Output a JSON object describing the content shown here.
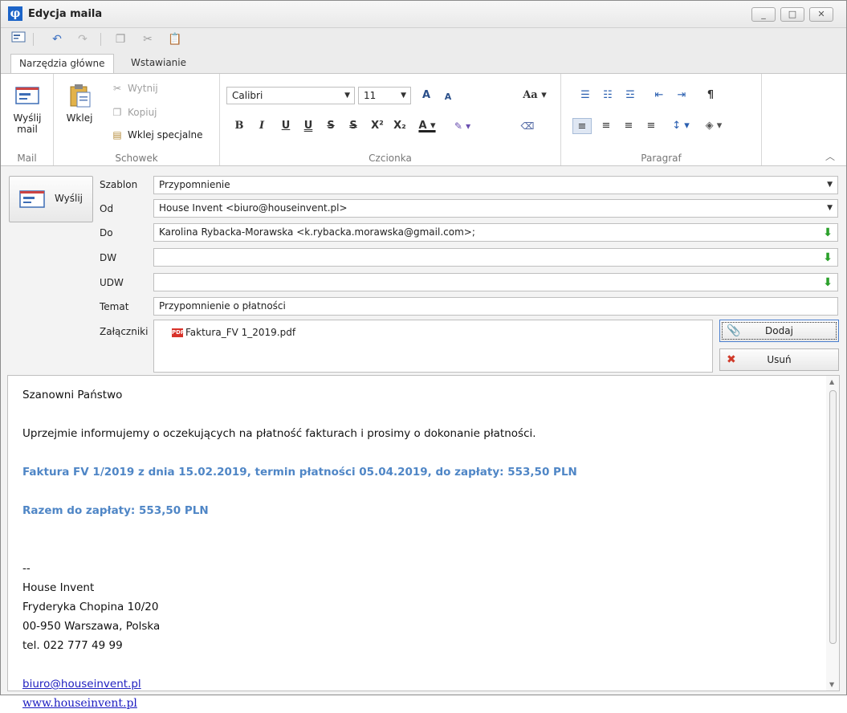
{
  "window": {
    "title": "Edycja maila",
    "minimize": "_",
    "maximize": "□",
    "close": "✕"
  },
  "tabs": [
    {
      "label": "Narzędzia główne"
    },
    {
      "label": "Wstawianie"
    }
  ],
  "ribbon": {
    "mail": {
      "caption": "Mail",
      "send_label_1": "Wyślij",
      "send_label_2": "mail"
    },
    "clipboard": {
      "caption": "Schowek",
      "paste": "Wklej",
      "cut": "Wytnij",
      "copy": "Kopiuj",
      "paste_special": "Wklej specjalne"
    },
    "font": {
      "caption": "Czcionka",
      "family": "Calibri",
      "size": "11",
      "bold": "B",
      "italic": "I",
      "underline": "U",
      "double_underline": "U",
      "strike": "S",
      "double_strike": "S",
      "superscript": "X²",
      "subscript": "X₂",
      "font_color": "A",
      "change_case": "Aa",
      "grow": "A",
      "shrink": "A"
    },
    "paragraph": {
      "caption": "Paragraf",
      "pilcrow": "¶"
    }
  },
  "form": {
    "send": "Wyślij",
    "labels": {
      "template": "Szablon",
      "from": "Od",
      "to": "Do",
      "cc": "DW",
      "bcc": "UDW",
      "subject": "Temat",
      "attachments": "Załączniki"
    },
    "template": "Przypomnienie",
    "from": "House Invent <biuro@houseinvent.pl>",
    "to": "Karolina Rybacka-Morawska <k.rybacka.morawska@gmail.com>;",
    "cc": "",
    "bcc": "",
    "subject": "Przypomnienie o płatności",
    "attachment_file": "Faktura_FV 1_2019.pdf",
    "add_button": "Dodaj",
    "remove_button": "Usuń"
  },
  "body": {
    "greeting": "Szanowni Państwo",
    "paragraph1": "Uprzejmie informujemy o oczekujących na płatność fakturach i prosimy o dokonanie płatności.",
    "invoice_line": "Faktura FV 1/2019 z dnia 15.02.2019, termin płatności 05.04.2019, do zapłaty: 553,50 PLN",
    "total_line": "Razem do zapłaty: 553,50 PLN",
    "signature_sep": "--",
    "company": "House Invent",
    "street": "Fryderyka Chopina 10/20",
    "city": "00-950 Warszawa, Polska",
    "phone": "tel. 022 777 49 99",
    "email": "biuro@houseinvent.pl",
    "website": "www.houseinvent.pl"
  },
  "colors": {
    "accent_blue": "#4f86c6",
    "window_icon": "#1c64c8",
    "arrow_green": "#2aa02a"
  }
}
